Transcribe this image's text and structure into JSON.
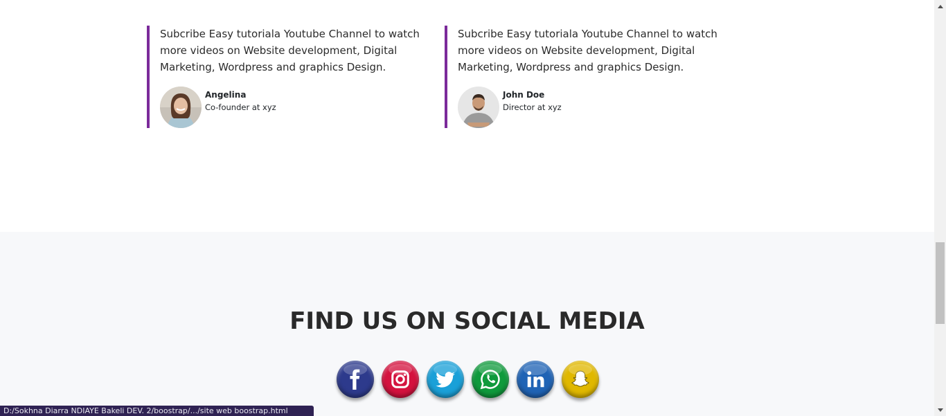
{
  "testimonials": [
    {
      "quote": "Subcribe Easy tutoriala Youtube Channel to watch more videos on Website development, Digital Marketing, Wordpress and graphics Design.",
      "name": "Angelina",
      "role": "Co-founder at xyz"
    },
    {
      "quote": "Subcribe Easy tutoriala Youtube Channel to watch more videos on Website development, Digital Marketing, Wordpress and graphics Design.",
      "name": "John Doe",
      "role": "Director at xyz"
    }
  ],
  "social": {
    "title": "FIND US ON SOCIAL MEDIA",
    "icons": [
      {
        "name": "facebook-icon",
        "color": "#2d3a8c"
      },
      {
        "name": "instagram-icon",
        "color": "#d4123e"
      },
      {
        "name": "twitter-icon",
        "color": "#1aa0d8"
      },
      {
        "name": "whatsapp-icon",
        "color": "#0f9a3c"
      },
      {
        "name": "linkedin-icon",
        "color": "#1f63b5"
      },
      {
        "name": "snapchat-icon",
        "color": "#e0b800"
      }
    ]
  },
  "status_bar": {
    "url": "D:/Sokhna Diarra NDIAYE Bakeli DEV. 2/boostrap/.../site web boostrap.html"
  },
  "colors": {
    "accent": "#7b2a9a",
    "section_bg": "#f7f8fa",
    "status_bg": "#2f2253"
  }
}
